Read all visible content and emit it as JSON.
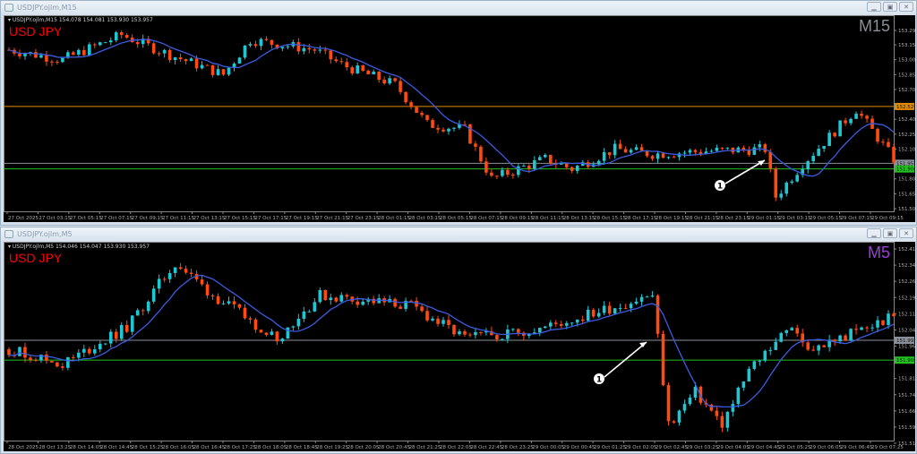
{
  "windows": [
    {
      "title": "USDJPY.ojlm,M15",
      "info": "▾ USDJPY.ojlm,M15  154.078 154.081 153.930 153.957",
      "symbol": "USD JPY",
      "timeframe": "M15",
      "timeframe_color": "#8a8f96",
      "price_ticks": [
        "153.295",
        "153.150",
        "153.000",
        "152.850",
        "152.700",
        "152.400",
        "152.250",
        "152.100",
        "151.800",
        "151.650",
        "151.500"
      ],
      "ymin": 151.5,
      "ymax": 153.295,
      "levels": [
        {
          "price": 152.529,
          "label": "152.529",
          "color": "#e08a00"
        },
        {
          "price": 151.957,
          "label": "151.957",
          "color": "#8a9099"
        },
        {
          "price": 151.9,
          "label": "151.900",
          "color": "#22c022"
        }
      ],
      "time_labels": [
        "27 Oct 2025",
        "27 Oct 03:15",
        "27 Oct 05:15",
        "27 Oct 07:15",
        "27 Oct 09:15",
        "27 Oct 11:15",
        "27 Oct 13:15",
        "27 Oct 15:15",
        "27 Oct 17:15",
        "27 Oct 19:15",
        "27 Oct 21:15",
        "27 Oct 23:15",
        "28 Oct 01:15",
        "28 Oct 03:15",
        "28 Oct 05:15",
        "28 Oct 07:15",
        "28 Oct 09:15",
        "28 Oct 11:15",
        "28 Oct 13:15",
        "28 Oct 15:15",
        "28 Oct 17:15",
        "28 Oct 19:15",
        "28 Oct 21:15",
        "28 Oct 23:15",
        "29 Oct 01:15",
        "29 Oct 03:15",
        "29 Oct 05:15",
        "29 Oct 07:15",
        "29 Oct 09:15"
      ],
      "annotation": "1",
      "price_path": [
        [
          0,
          153.1
        ],
        [
          10,
          153.0
        ],
        [
          21,
          153.25
        ],
        [
          30,
          153.05
        ],
        [
          40,
          152.85
        ],
        [
          45,
          153.2
        ],
        [
          57,
          153.1
        ],
        [
          62,
          152.95
        ],
        [
          72,
          152.75
        ],
        [
          78,
          152.35
        ],
        [
          85,
          152.3
        ],
        [
          90,
          151.8
        ],
        [
          100,
          152.0
        ],
        [
          105,
          151.9
        ],
        [
          113,
          152.1
        ],
        [
          120,
          152.05
        ],
        [
          130,
          152.08
        ],
        [
          141,
          152.1
        ],
        [
          143,
          151.62
        ],
        [
          148,
          151.95
        ],
        [
          158,
          152.5
        ],
        [
          165,
          152.0
        ]
      ]
    },
    {
      "title": "USDJPY.ojlm,M5",
      "info": "▾ USDJPY.ojlm,M5  154.046 154.047 153.930 153.957",
      "symbol": "USD JPY",
      "timeframe": "M5",
      "timeframe_color": "#9a3fd8",
      "price_ticks": [
        "152.415",
        "152.340",
        "152.265",
        "152.190",
        "152.115",
        "152.040",
        "151.965",
        "151.815",
        "151.740",
        "151.665",
        "151.590",
        "151.515"
      ],
      "ymin": 151.515,
      "ymax": 152.415,
      "levels": [
        {
          "price": 151.992,
          "label": "151.992",
          "color": "#8a9099"
        },
        {
          "price": 151.9,
          "label": "151.900",
          "color": "#22c022"
        }
      ],
      "time_labels": [
        "28 Oct 2025",
        "28 Oct 13:25",
        "28 Oct 14:05",
        "28 Oct 14:45",
        "28 Oct 15:25",
        "28 Oct 16:05",
        "28 Oct 16:45",
        "28 Oct 17:25",
        "28 Oct 18:05",
        "28 Oct 18:45",
        "28 Oct 19:25",
        "28 Oct 20:05",
        "28 Oct 20:45",
        "28 Oct 21:25",
        "28 Oct 22:05",
        "28 Oct 22:45",
        "28 Oct 23:25",
        "29 Oct 00:05",
        "29 Oct 00:45",
        "29 Oct 01:25",
        "29 Oct 02:05",
        "29 Oct 02:45",
        "29 Oct 03:25",
        "29 Oct 04:05",
        "29 Oct 04:45",
        "29 Oct 05:25",
        "29 Oct 06:05",
        "29 Oct 06:45",
        "29 Oct 07:25"
      ],
      "annotation": "1",
      "price_path": [
        [
          0,
          151.95
        ],
        [
          10,
          151.88
        ],
        [
          22,
          152.05
        ],
        [
          31,
          152.35
        ],
        [
          38,
          152.2
        ],
        [
          50,
          152.0
        ],
        [
          58,
          152.2
        ],
        [
          75,
          152.15
        ],
        [
          85,
          152.0
        ],
        [
          100,
          152.05
        ],
        [
          120,
          152.2
        ],
        [
          123,
          151.6
        ],
        [
          128,
          151.75
        ],
        [
          133,
          151.6
        ],
        [
          138,
          151.85
        ],
        [
          145,
          152.05
        ],
        [
          150,
          151.95
        ],
        [
          165,
          152.1
        ]
      ]
    }
  ],
  "colors": {
    "bull": "#1fc7d4",
    "bear": "#ff4a10",
    "ma": "#3c5ce0"
  }
}
